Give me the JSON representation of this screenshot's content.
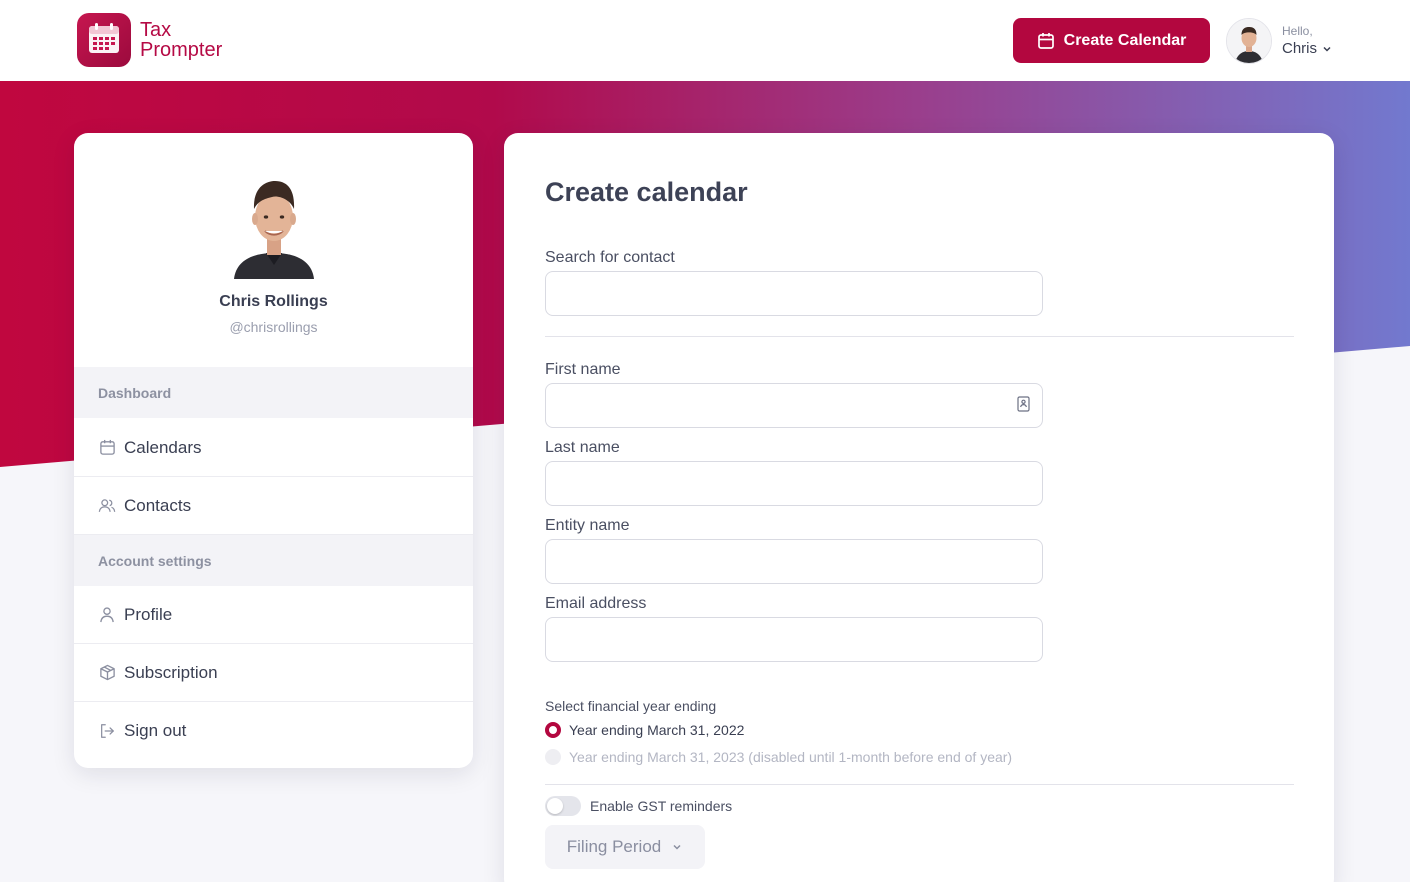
{
  "brand": {
    "line1": "Tax",
    "line2": "Prompter",
    "icon": "calendar-logo-icon"
  },
  "header": {
    "create_button_label": "Create Calendar",
    "greeting": "Hello,",
    "user_first_name": "Chris"
  },
  "profile": {
    "name": "Chris Rollings",
    "handle": "@chrisrollings"
  },
  "sidebar": {
    "sections": [
      {
        "title": "Dashboard"
      },
      {
        "title": "Account settings"
      }
    ],
    "items": [
      {
        "label": "Calendars",
        "icon": "calendar-icon"
      },
      {
        "label": "Contacts",
        "icon": "users-icon"
      },
      {
        "label": "Profile",
        "icon": "user-icon"
      },
      {
        "label": "Subscription",
        "icon": "box-icon"
      },
      {
        "label": "Sign out",
        "icon": "sign-out-icon"
      }
    ]
  },
  "form": {
    "title": "Create calendar",
    "search_label": "Search for contact",
    "search_value": "",
    "first_name_label": "First name",
    "first_name_value": "",
    "last_name_label": "Last name",
    "last_name_value": "",
    "entity_name_label": "Entity name",
    "entity_name_value": "",
    "email_label": "Email address",
    "email_value": "",
    "fy_label": "Select financial year ending",
    "fy_options": [
      {
        "label": "Year ending March 31, 2022",
        "selected": true,
        "disabled": false
      },
      {
        "label": "Year ending March 31, 2023 (disabled until 1-month before end of year)",
        "selected": false,
        "disabled": true
      }
    ],
    "gst_label": "Enable GST reminders",
    "gst_enabled": false,
    "filing_period_label": "Filing Period"
  },
  "colors": {
    "brand": "#b3073f",
    "gradient_start": "#c0073f",
    "gradient_end": "#7279cf",
    "page_background": "#f6f6fa"
  }
}
